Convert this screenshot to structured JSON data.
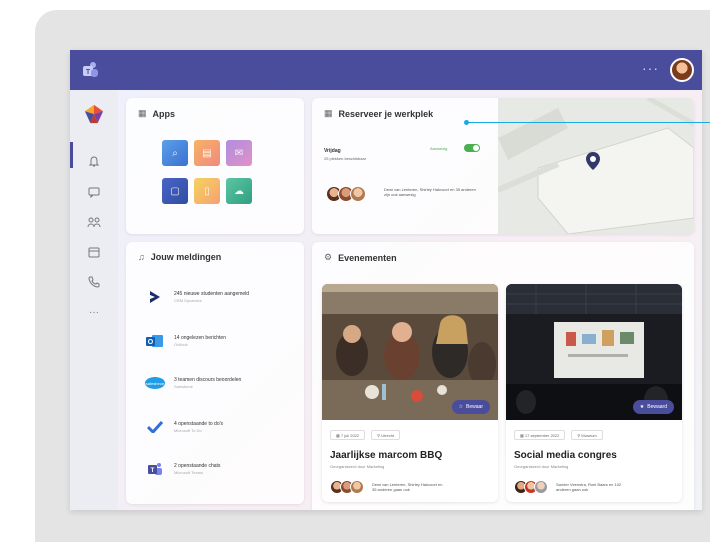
{
  "topbar": {
    "more": "···"
  },
  "rail": {
    "more": "···"
  },
  "apps": {
    "title": "Apps"
  },
  "reserve": {
    "title": "Reserveer je werkplek",
    "day": "Vrijdag",
    "places": "25 plekken beschikbaar",
    "toggle_label": "Aanwezig",
    "toggle_on": true,
    "colleagues_text": "Dewi van Lenteren, Shirley Hakvoort en 35 anderen zijn ook aanwezig"
  },
  "notifications": {
    "title": "Jouw meldingen",
    "items": [
      {
        "icon": "dynamics-icon",
        "text": "245 nieuwe studenten aangemeld",
        "sub": "CRM Dynamics"
      },
      {
        "icon": "outlook-icon",
        "text": "14 ongelezen berichten",
        "sub": "Outlook"
      },
      {
        "icon": "salesforce-icon",
        "text": "3 teamen discours beoordelen",
        "sub": "Salesforce"
      },
      {
        "icon": "todo-icon",
        "text": "4 openstaande to do's",
        "sub": "Microsoft To Do"
      },
      {
        "icon": "teams-icon",
        "text": "2 openstaande chats",
        "sub": "Microsoft Teams"
      }
    ]
  },
  "events": {
    "title": "Evenementen",
    "items": [
      {
        "badge": "Bewaar",
        "date": "7 juli 2022",
        "location": "Utrecht",
        "title": "Jaarlijkse marcom BBQ",
        "sub": "Georganiseerd door Marketing",
        "people_text": "Dewi van Lenteren, Shirley Hakvoort en 35 anderen gaan ook"
      },
      {
        "badge": "Bewaard",
        "date": "17 september 2022",
        "location": "Museum",
        "title": "Social media congres",
        "sub": "Georganiseerd door Marketing",
        "people_text": "Sander Veenstra, Roel Baars en 102 anderen gaan ook"
      }
    ]
  },
  "colors": {
    "brand": "#4a4d9c",
    "callout": "#18a9e6",
    "toggle": "#4caf50"
  }
}
